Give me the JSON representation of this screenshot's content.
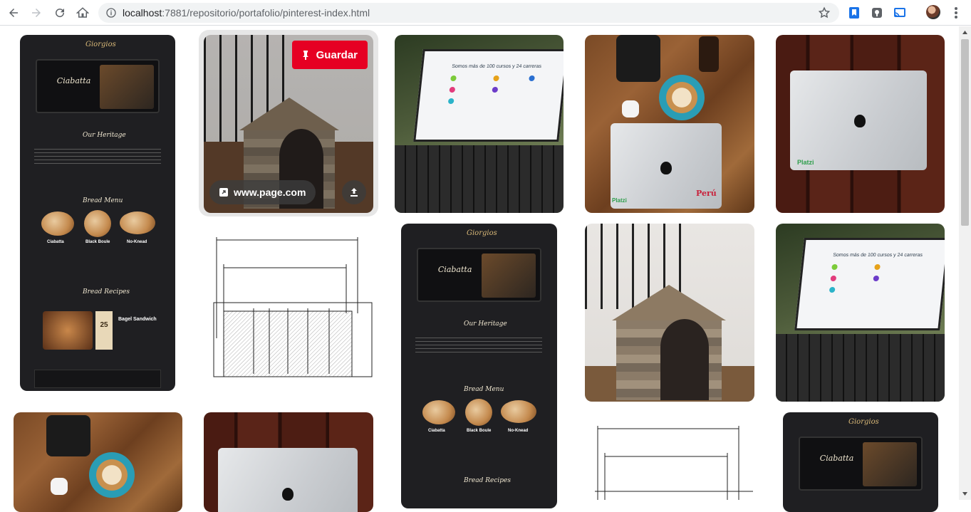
{
  "browser": {
    "url_host": "localhost",
    "url_port_path": ":7881/repositorio/portafolio/pinterest-index.html",
    "back_icon": "arrow-left-icon",
    "forward_icon": "arrow-right-icon",
    "reload_icon": "reload-icon",
    "home_icon": "home-icon",
    "info_icon": "info-icon",
    "bookmark_icon": "star-icon",
    "extensions": [
      "bookmark-ext-icon",
      "pocket-ext-icon",
      "cast-icon"
    ],
    "menu_icon": "more-vert-icon"
  },
  "hover_pin": {
    "save_label": "Guardar",
    "save_icon": "pushpin-icon",
    "link_text": "www.page.com",
    "link_icon": "external-link-icon",
    "share_icon": "upload-icon"
  },
  "website_mock": {
    "brand": "Giorgios",
    "hero_title": "Ciabatta",
    "heritage": "Our Heritage",
    "bread_menu": "Bread Menu",
    "bread_recipes": "Bread Recipes",
    "items": [
      "Ciabatta",
      "Black Boule",
      "No-Knead"
    ],
    "recipe_title": "Bagel Sandwich",
    "recipe_number": "25"
  },
  "laptop_pin": {
    "headline": "Somos más de 100 cursos y 24 carreras"
  },
  "stickers": {
    "platzi": "Platzi",
    "peru": "Perú"
  },
  "colors": {
    "save_red": "#e60023",
    "chrome_bg": "#f1f3f4"
  }
}
